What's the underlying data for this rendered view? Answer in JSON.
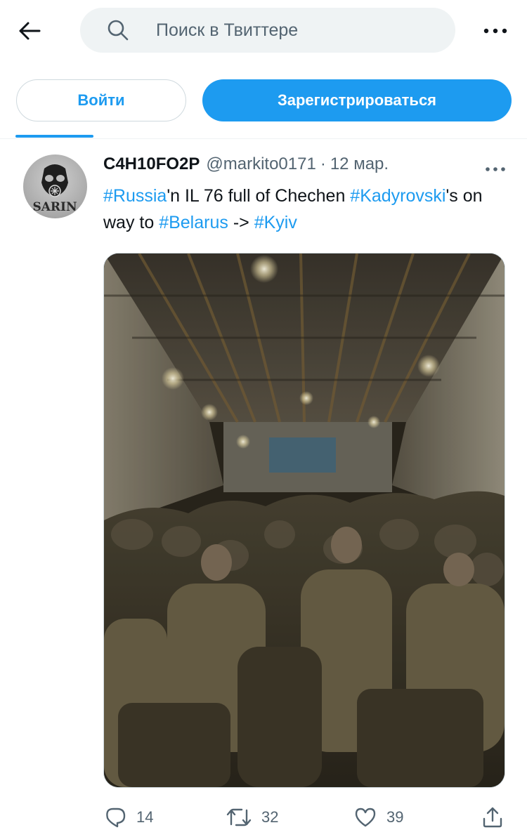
{
  "search": {
    "placeholder": "Поиск в Твиттере"
  },
  "auth": {
    "login_label": "Войти",
    "signup_label": "Зарегистрироваться"
  },
  "tweet": {
    "author_name": "C4H10FO2P",
    "handle": "@markito0171",
    "separator": "·",
    "date": "12 мар.",
    "avatar_text": "SARIN",
    "text_parts": [
      {
        "text": "#Russia",
        "type": "hashtag"
      },
      {
        "text": "'n IL 76 full of Chechen ",
        "type": "text"
      },
      {
        "text": "#Kadyrovski",
        "type": "hashtag"
      },
      {
        "text": "'s on way to ",
        "type": "text"
      },
      {
        "text": "#Belarus",
        "type": "hashtag"
      },
      {
        "text": " -> ",
        "type": "text"
      },
      {
        "text": "#Kyiv",
        "type": "hashtag"
      }
    ],
    "replies": "14",
    "retweets": "32",
    "likes": "39"
  },
  "colors": {
    "accent": "#1d9bf0",
    "text": "#0f1419",
    "secondary": "#536471",
    "border": "#cfd9de"
  },
  "icons": {
    "back": "arrow-left-icon",
    "search": "search-icon",
    "more": "more-dots-icon",
    "reply": "reply-icon",
    "retweet": "retweet-icon",
    "like": "heart-icon",
    "share": "share-icon"
  }
}
